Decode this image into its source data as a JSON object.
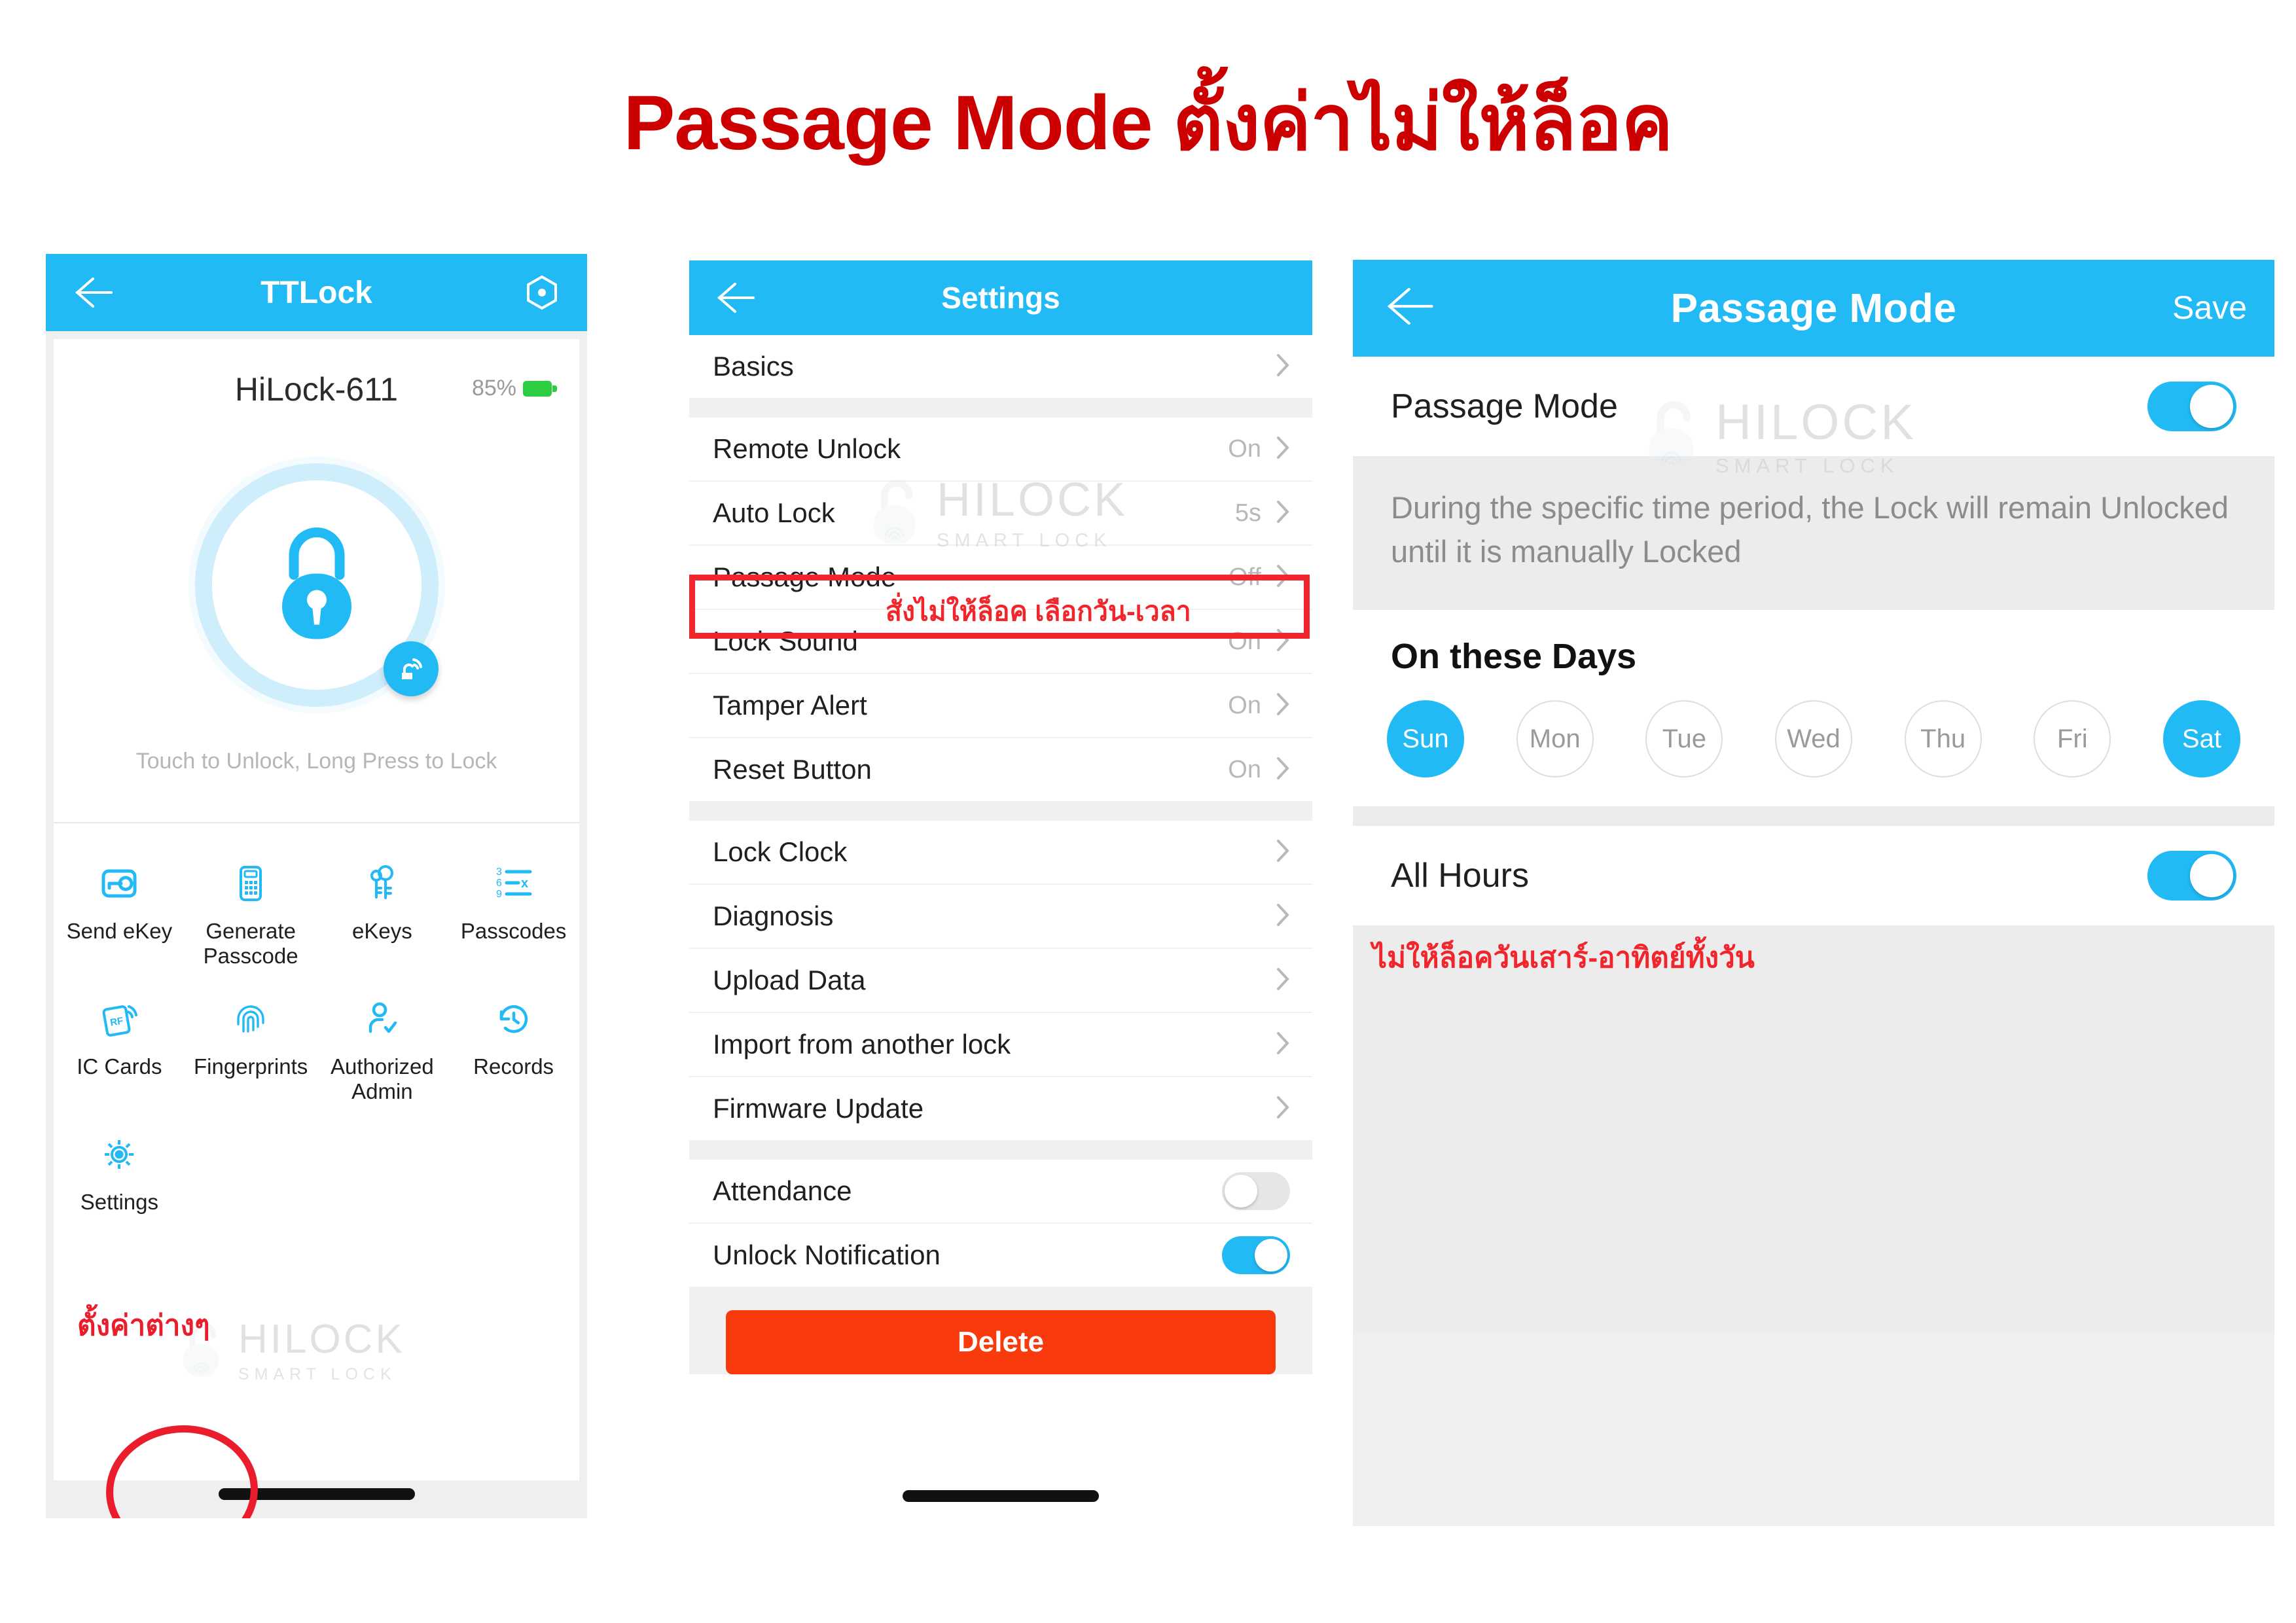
{
  "page": {
    "title": "Passage Mode ตั้งค่าไม่ให้ล็อค",
    "accent_blue": "#22BAF5",
    "annotation_red": "#ea1d2c",
    "delete_red": "#f93a0c"
  },
  "watermark": {
    "main": "HILOCK",
    "sub": "SMART LOCK"
  },
  "panel1": {
    "header": {
      "title": "TTLock",
      "back_icon": "back-arrow-icon",
      "right_icon": "hexagon-dot-icon"
    },
    "lock_name": "HiLock-611",
    "battery_percent": "85%",
    "lock_icon": "padlock-icon",
    "bluetooth_badge_icon": "bluetooth-unlock-icon",
    "touch_hint": "Touch to Unlock, Long Press to Lock",
    "grid": [
      {
        "label": "Send eKey",
        "icon": "send-ekey-icon"
      },
      {
        "label": "Generate\nPasscode",
        "icon": "calculator-icon"
      },
      {
        "label": "eKeys",
        "icon": "keys-icon"
      },
      {
        "label": "Passcodes",
        "icon": "passcode-list-icon"
      },
      {
        "label": "IC Cards",
        "icon": "rf-card-icon"
      },
      {
        "label": "Fingerprints",
        "icon": "fingerprint-icon"
      },
      {
        "label": "Authorized\nAdmin",
        "icon": "user-check-icon"
      },
      {
        "label": "Records",
        "icon": "clock-history-icon"
      },
      {
        "label": "Settings",
        "icon": "gear-icon"
      }
    ],
    "annotation": "ตั้งค่าต่างๆ"
  },
  "panel2": {
    "header": {
      "title": "Settings",
      "back_icon": "back-arrow-icon"
    },
    "rows": [
      {
        "label": "Basics",
        "value": "",
        "type": "chevron"
      },
      {
        "label": "Remote Unlock",
        "value": "On",
        "type": "chevron"
      },
      {
        "label": "Auto Lock",
        "value": "5s",
        "type": "chevron"
      },
      {
        "label": "Passage Mode",
        "value": "Off",
        "type": "chevron"
      },
      {
        "label": "Lock Sound",
        "value": "On",
        "type": "chevron"
      },
      {
        "label": "Tamper Alert",
        "value": "On",
        "type": "chevron"
      },
      {
        "label": "Reset Button",
        "value": "On",
        "type": "chevron"
      },
      {
        "label": "Lock Clock",
        "value": "",
        "type": "chevron"
      },
      {
        "label": "Diagnosis",
        "value": "",
        "type": "chevron"
      },
      {
        "label": "Upload Data",
        "value": "",
        "type": "chevron"
      },
      {
        "label": "Import from another lock",
        "value": "",
        "type": "chevron"
      },
      {
        "label": "Firmware Update",
        "value": "",
        "type": "chevron"
      },
      {
        "label": "Attendance",
        "value": "off",
        "type": "toggle"
      },
      {
        "label": "Unlock Notification",
        "value": "on",
        "type": "toggle"
      }
    ],
    "delete_label": "Delete",
    "annotation": "สั่งไม่ให้ล็อค เลือกวัน-เวลา"
  },
  "panel3": {
    "header": {
      "title": "Passage Mode",
      "back_icon": "back-arrow-icon",
      "save_label": "Save"
    },
    "passage_mode_label": "Passage Mode",
    "passage_mode_state": "on",
    "description": "During the specific time period, the Lock will remain Unlocked until it is manually Locked",
    "days_title": "On these Days",
    "days": [
      {
        "label": "Sun",
        "selected": true
      },
      {
        "label": "Mon",
        "selected": false
      },
      {
        "label": "Tue",
        "selected": false
      },
      {
        "label": "Wed",
        "selected": false
      },
      {
        "label": "Thu",
        "selected": false
      },
      {
        "label": "Fri",
        "selected": false
      },
      {
        "label": "Sat",
        "selected": true
      }
    ],
    "all_hours_label": "All Hours",
    "all_hours_state": "on",
    "annotation": "ไม่ให้ล็อควันเสาร์-อาทิตย์ทั้งวัน"
  }
}
